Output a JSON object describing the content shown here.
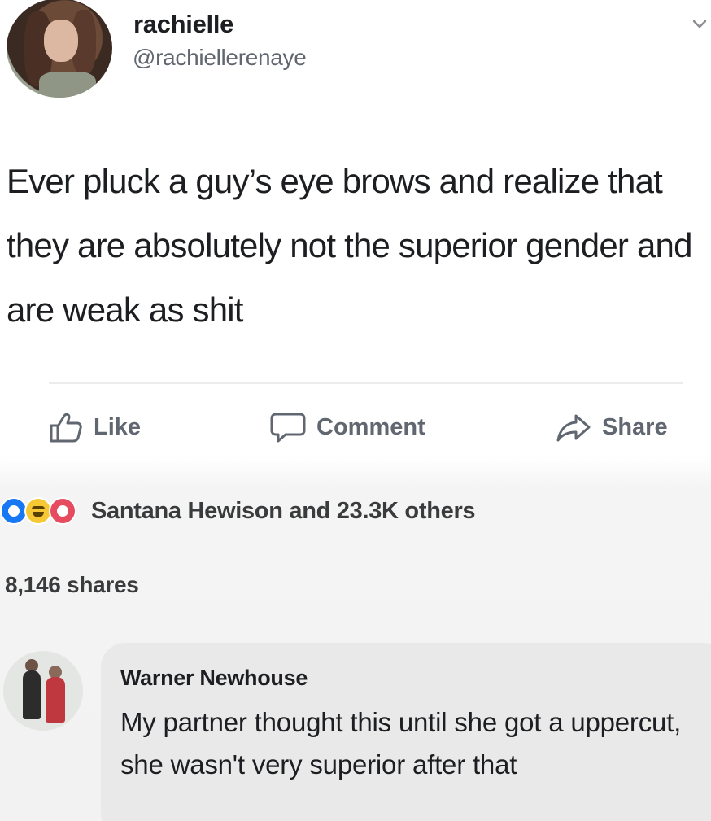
{
  "post": {
    "author_name": "rachielle",
    "author_handle": "@rachiellerenaye",
    "text": "Ever pluck a guy’s eye brows and realize that they are absolutely not the superior gender and are weak as shit"
  },
  "actions": {
    "like_label": "Like",
    "comment_label": "Comment",
    "share_label": "Share"
  },
  "reactions": {
    "icons": [
      "like-reaction",
      "haha-reaction",
      "love-reaction"
    ],
    "summary": "Santana Hewison and 23.3K others"
  },
  "shares": {
    "count_label": "8,146 shares"
  },
  "comment": {
    "author_name": "Warner Newhouse",
    "text": "My partner thought this until she got a uppercut, she wasn't very superior after that"
  },
  "colors": {
    "like_blue": "#1877f2",
    "love_red": "#e74b5f",
    "haha_yellow": "#f7c835",
    "muted_text": "#606770",
    "comment_bubble": "#e9e9e9"
  }
}
